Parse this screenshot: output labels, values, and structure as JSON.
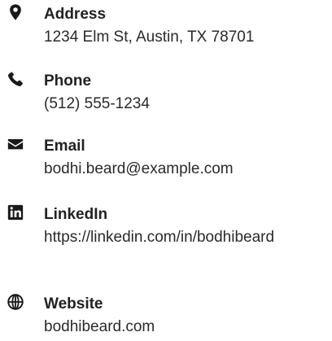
{
  "contact": {
    "items": [
      {
        "icon": "map-pin-icon",
        "label": "Address",
        "value": "1234 Elm St, Austin, TX 78701"
      },
      {
        "icon": "phone-icon",
        "label": "Phone",
        "value": "(512) 555-1234"
      },
      {
        "icon": "envelope-icon",
        "label": "Email",
        "value": "bodhi.beard@example.com"
      },
      {
        "icon": "linkedin-icon",
        "label": "LinkedIn",
        "value": "https://linkedin.com/in/bodhibeard"
      },
      {
        "icon": "globe-icon",
        "label": "Website",
        "value": "bodhibeard.com"
      }
    ]
  },
  "colors": {
    "text": "#222222",
    "icon": "#1a1a1a"
  }
}
